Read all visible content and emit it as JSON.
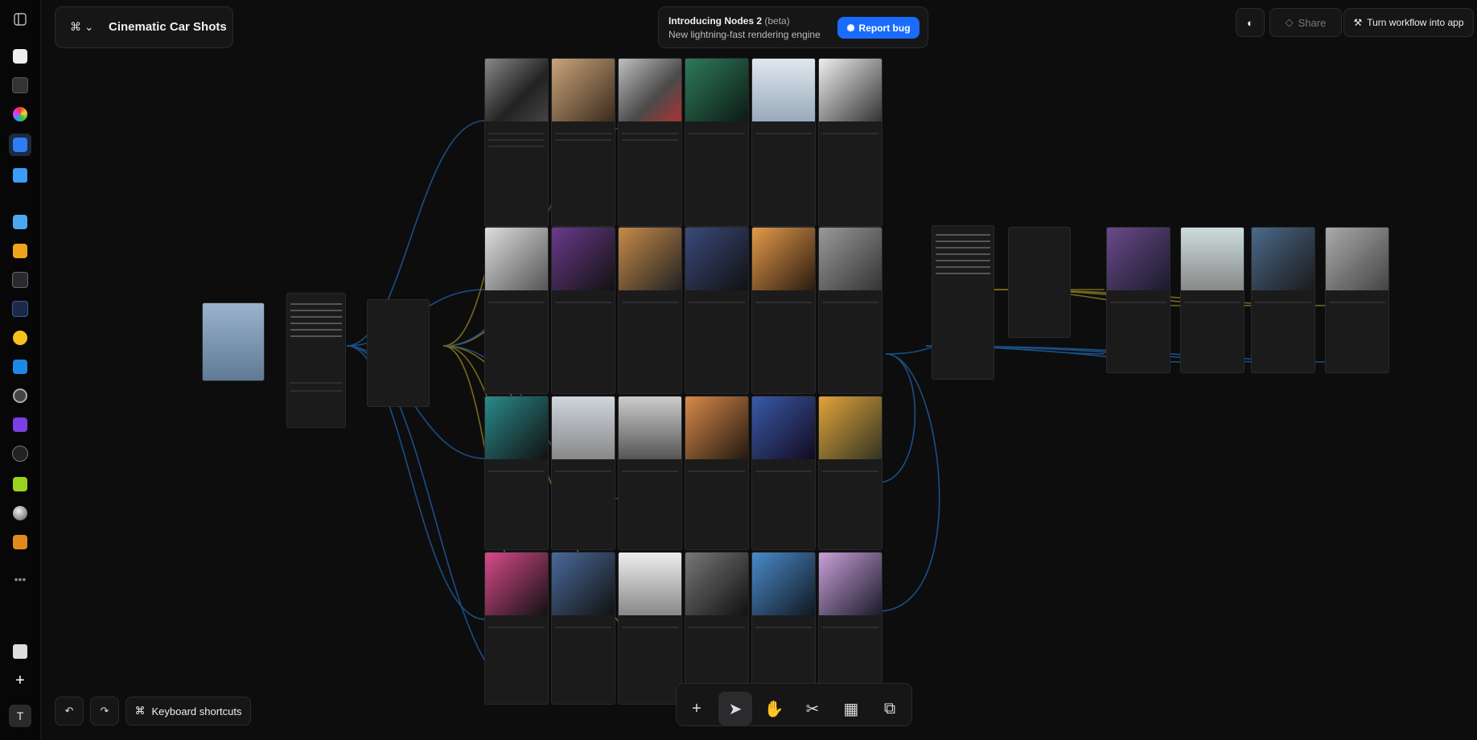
{
  "app": {
    "title": "Cinematic Car Shots"
  },
  "banner": {
    "title": "Introducing Nodes 2",
    "beta": "(beta)",
    "subtitle": "New lightning-fast rendering engine",
    "report_label": "Report bug"
  },
  "header": {
    "share_label": "Share",
    "turn_into_app_label": "Turn workflow into app"
  },
  "footer": {
    "keyboard_shortcuts_label": "Keyboard shortcuts",
    "user_initial": "T"
  },
  "rail": {
    "icons": [
      "panel-toggle-icon",
      "home-icon",
      "pen-icon",
      "color-wheel-icon",
      "nodes-icon",
      "folder-icon",
      "image-icon",
      "video-icon",
      "magic-wand-icon",
      "chart-icon",
      "lightbulb-icon",
      "vector-icon",
      "disc-icon",
      "app-icon",
      "microphone-icon",
      "figure-icon",
      "sphere-icon",
      "film-icon",
      "more-icon"
    ]
  },
  "colors": {
    "accent": "#1a6cff",
    "wire_blue": "#1e5a9a",
    "wire_yellow": "#8a7a20",
    "canvas_bg": "#0d0d0e"
  }
}
